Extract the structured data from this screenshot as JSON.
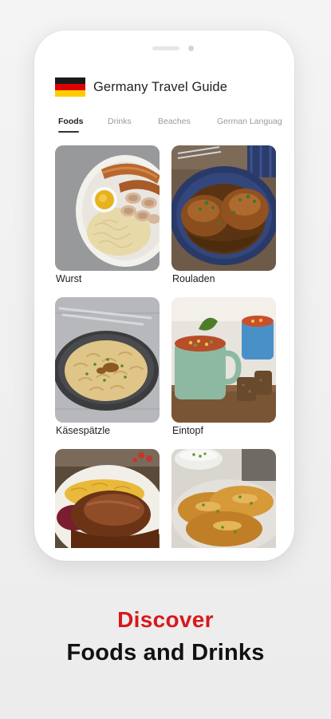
{
  "app": {
    "title": "Germany Travel Guide",
    "flag_icon": "germany-flag-icon"
  },
  "tabs": [
    {
      "label": "Foods",
      "active": true
    },
    {
      "label": "Drinks",
      "active": false
    },
    {
      "label": "Beaches",
      "active": false
    },
    {
      "label": "German Languag",
      "active": false
    }
  ],
  "foods": [
    {
      "name": "Wurst"
    },
    {
      "name": "Rouladen"
    },
    {
      "name": "Käsespätzle"
    },
    {
      "name": "Eintopf"
    },
    {
      "name": ""
    },
    {
      "name": ""
    }
  ],
  "tagline": {
    "line1": "Discover",
    "line2": "Foods and Drinks"
  },
  "colors": {
    "accent_red": "#d7191c",
    "text_dark": "#111111",
    "tab_inactive": "#9a9a9a"
  }
}
